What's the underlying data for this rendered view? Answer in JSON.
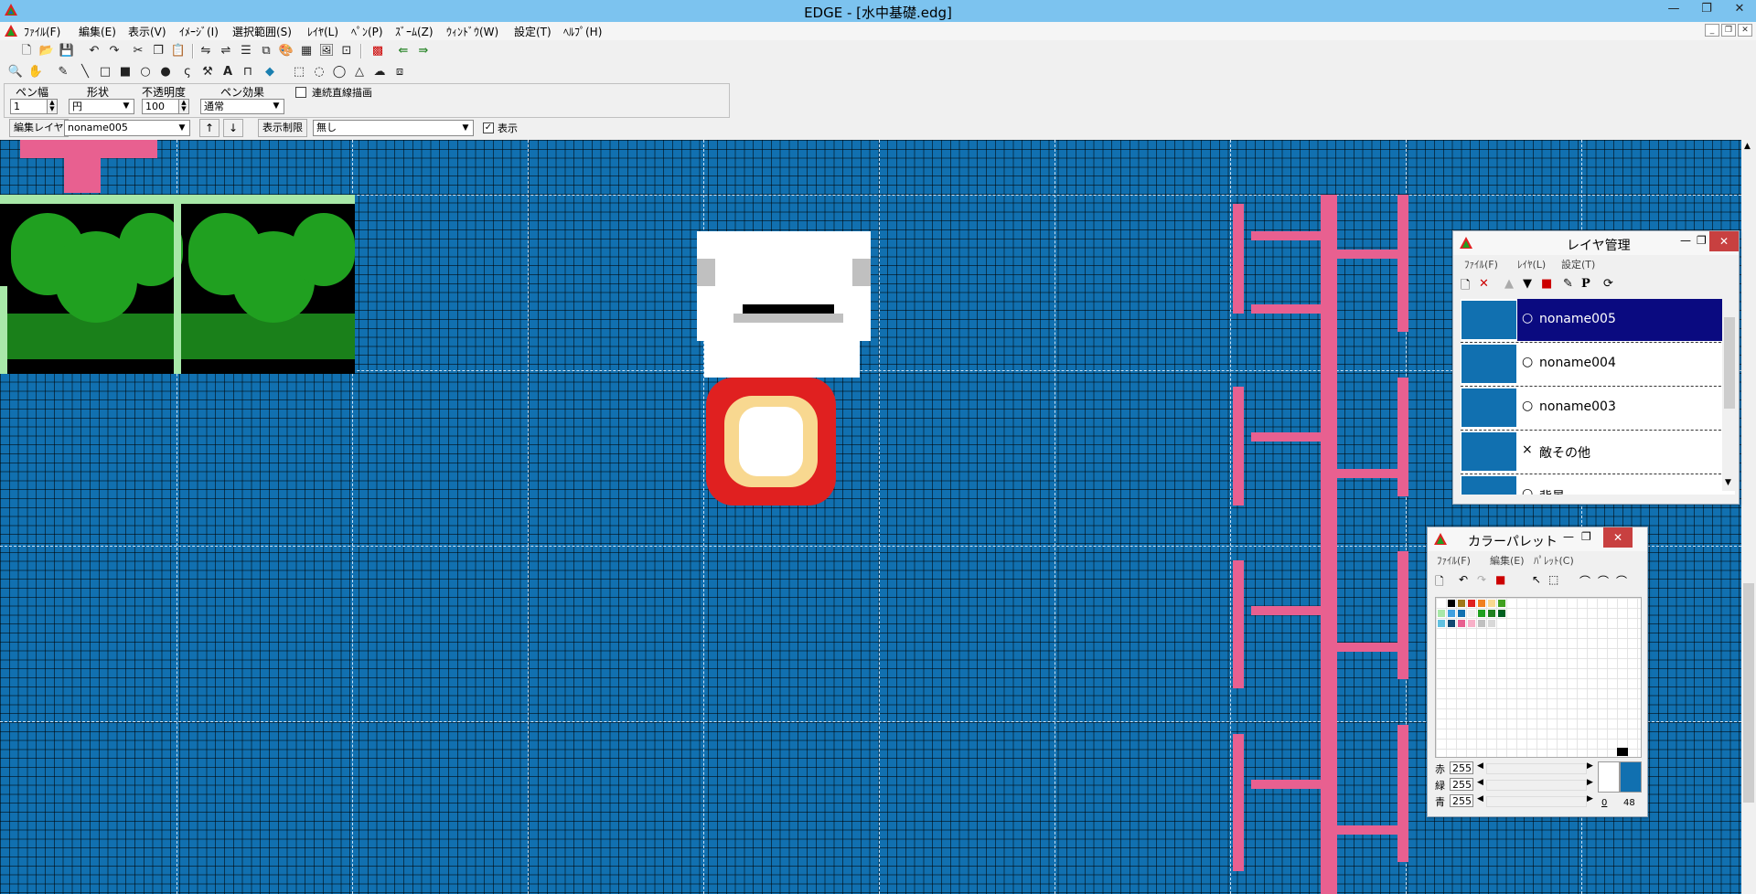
{
  "window": {
    "title": "EDGE - [水中基礎.edg]",
    "controls": [
      "—",
      "❐",
      "✕"
    ]
  },
  "menu": [
    "ﾌｧｲﾙ(F)",
    "編集(E)",
    "表示(V)",
    "ｲﾒｰｼﾞ(I)",
    "選択範囲(S)",
    "ﾚｲﾔ(L)",
    "ﾍﾟﾝ(P)",
    "ｽﾞｰﾑ(Z)",
    "ｳｨﾝﾄﾞｳ(W)",
    "設定(T)",
    "ﾍﾙﾌﾟ(H)"
  ],
  "pen": {
    "width_label": "ペン幅",
    "width_value": "1",
    "shape_label": "形状",
    "shape_value": "円",
    "opacity_label": "不透明度",
    "opacity_value": "100",
    "effect_label": "ペン効果",
    "effect_value": "通常",
    "continuous_label": "連続直線描画"
  },
  "layer_bar": {
    "edit_layer_label": "編集レイヤ",
    "edit_layer_value": "noname005",
    "up": "↑",
    "down": "↓",
    "display_limit_label": "表示制限",
    "display_limit_value": "無し",
    "show_label": "表示"
  },
  "layer_panel": {
    "title": "レイヤ管理",
    "menu": [
      "ﾌｧｲﾙ(F)",
      "ﾚｲﾔ(L)",
      "設定(T)"
    ],
    "layers": [
      {
        "vis": "○",
        "name": "noname005"
      },
      {
        "vis": "○",
        "name": "noname004"
      },
      {
        "vis": "○",
        "name": "noname003"
      },
      {
        "vis": "×",
        "name": "敵その他"
      },
      {
        "vis": "○",
        "name": "背景"
      }
    ]
  },
  "palette_panel": {
    "title": "カラーパレット",
    "menu": [
      "ﾌｧｲﾙ(F)",
      "編集(E)",
      "ﾊﾟﾚｯﾄ(C)"
    ],
    "colors": [
      "#ffffff",
      "#000000",
      "#a07818",
      "#e02020",
      "#f08020",
      "#f8d890",
      "#40a020",
      "#a8e8a8",
      "#40a0e0",
      "#1170b0",
      "#f0f0f0",
      "#20a020",
      "#208020",
      "#006020",
      "#60c0e0",
      "#104870",
      "#e86090",
      "#f8b0c8",
      "#c0c0c0",
      "#d8d8d8"
    ],
    "r_label": "赤",
    "r_value": "255",
    "g_label": "緑",
    "g_value": "255",
    "b_label": "青",
    "b_value": "255",
    "index_a": "0",
    "index_b": "48"
  }
}
